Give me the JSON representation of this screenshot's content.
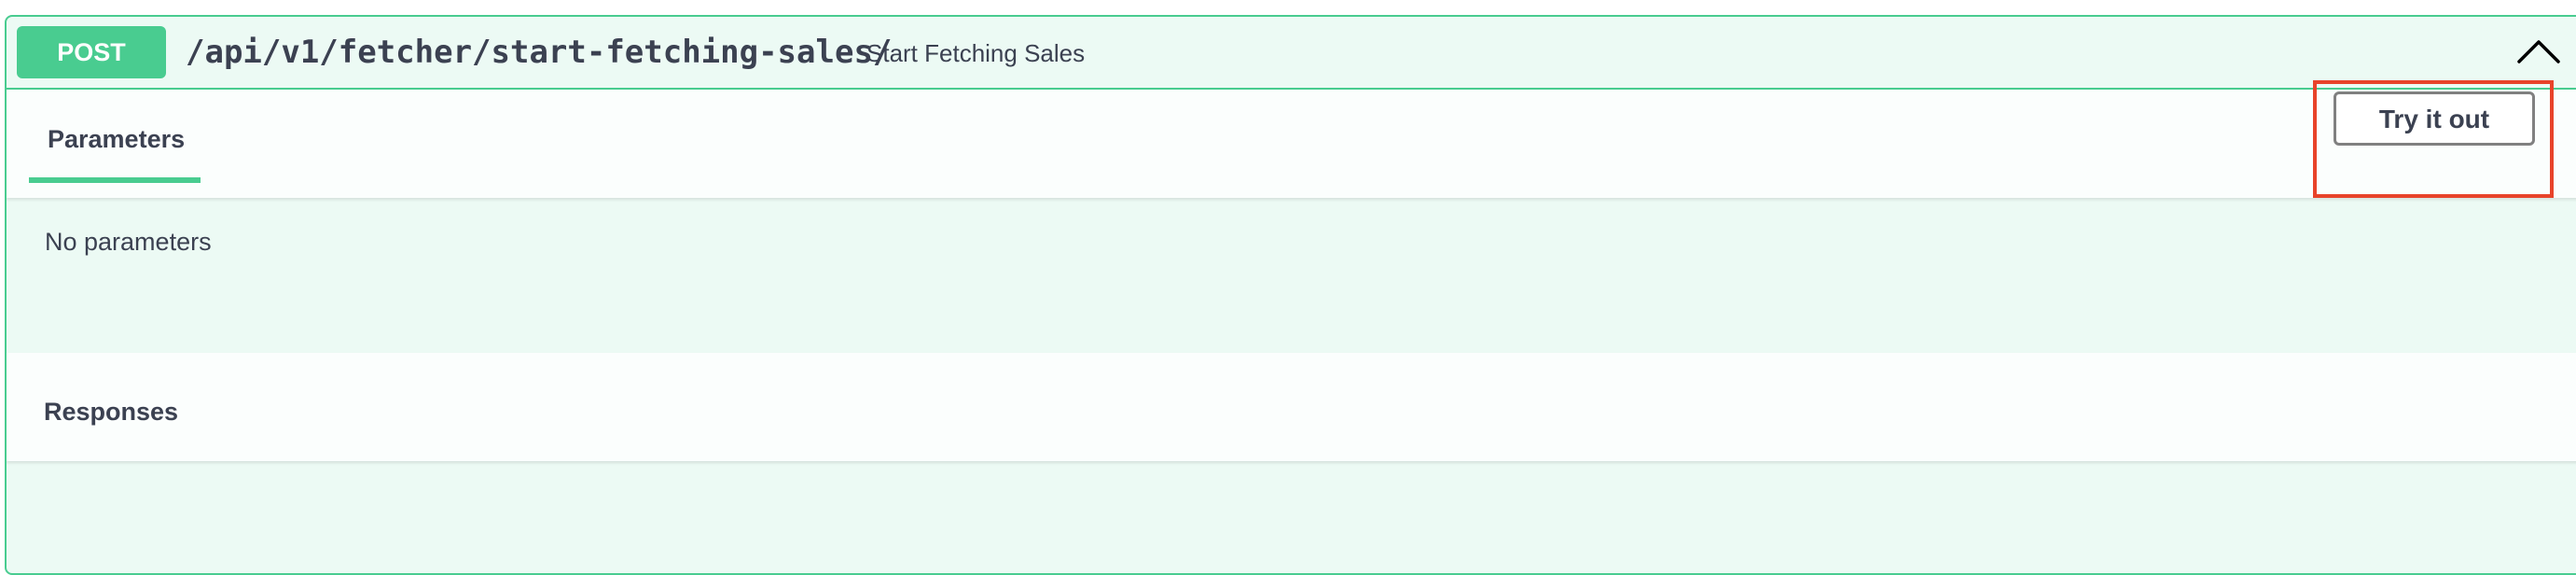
{
  "summary": {
    "method": "POST",
    "path": "/api/v1/fetcher/start-fetching-sales/",
    "description": "Start Fetching Sales",
    "toggle_icon": "chevron-up-icon"
  },
  "parameters": {
    "tab_label": "Parameters",
    "try_button_label": "Try it out",
    "empty_message": "No parameters"
  },
  "responses": {
    "title": "Responses"
  },
  "colors": {
    "post_accent": "#49cc90",
    "text": "#3b4151",
    "highlight": "#e8432a"
  }
}
